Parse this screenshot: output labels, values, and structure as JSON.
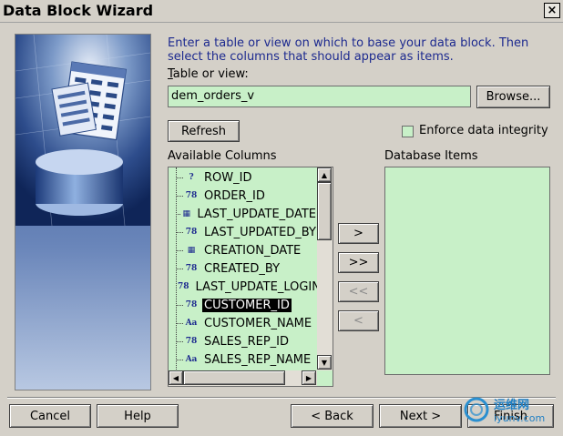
{
  "window": {
    "title": "Data Block Wizard",
    "close_glyph": "×"
  },
  "instructions": "Enter a table or view on which to base your data block. Then select the columns that should appear as items.",
  "table_label_prefix": "T",
  "table_label_rest": "able or view:",
  "table_value": "dem_orders_v",
  "browse_label": "Browse...",
  "refresh_label": "Refresh",
  "enforce_label": "Enforce data integrity",
  "enforce_checked": false,
  "available_label": "Available Columns",
  "database_label": "Database Items",
  "columns": [
    {
      "name": "ROW_ID",
      "icon": "unknown-type-icon"
    },
    {
      "name": "ORDER_ID",
      "icon": "number-type-icon"
    },
    {
      "name": "LAST_UPDATE_DATE",
      "icon": "date-type-icon"
    },
    {
      "name": "LAST_UPDATED_BY",
      "icon": "number-type-icon"
    },
    {
      "name": "CREATION_DATE",
      "icon": "date-type-icon"
    },
    {
      "name": "CREATED_BY",
      "icon": "number-type-icon"
    },
    {
      "name": "LAST_UPDATE_LOGIN",
      "icon": "number-type-icon"
    },
    {
      "name": "CUSTOMER_ID",
      "icon": "number-type-icon"
    },
    {
      "name": "CUSTOMER_NAME",
      "icon": "text-type-icon"
    },
    {
      "name": "SALES_REP_ID",
      "icon": "number-type-icon"
    },
    {
      "name": "SALES_REP_NAME",
      "icon": "text-type-icon"
    }
  ],
  "selected_column": "CUSTOMER_ID",
  "move_buttons": {
    "add": ">",
    "add_all": ">>",
    "remove_all": "<<",
    "remove": "<"
  },
  "footer": {
    "cancel": "Cancel",
    "help": "Help",
    "back": "< Back",
    "next": "Next >",
    "finish": "Finish"
  },
  "watermark": {
    "line1": "运维网",
    "line2": "iyunv.com"
  },
  "colors": {
    "dialog_bg": "#d4d0c8",
    "field_bg": "#c8f0c8",
    "instruction_text": "#1d2a8f",
    "selection_bg": "#000000"
  }
}
